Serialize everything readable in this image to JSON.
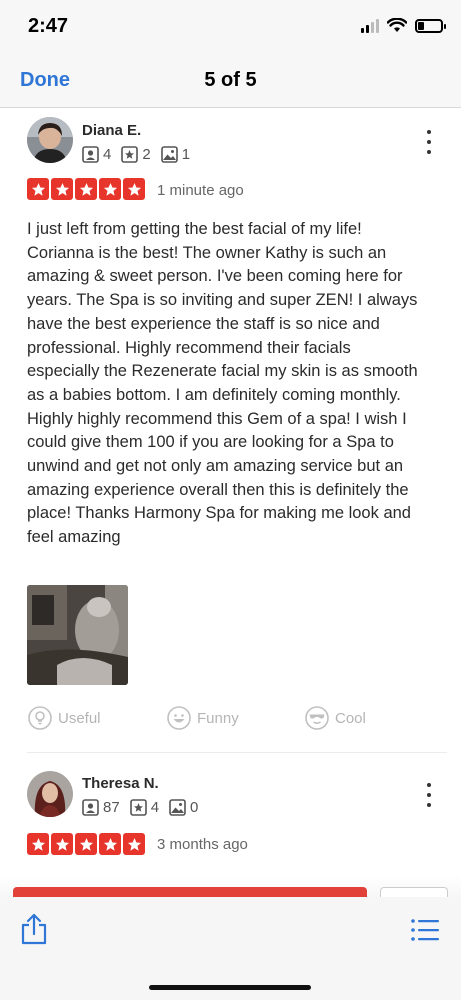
{
  "status_bar": {
    "time": "2:47"
  },
  "nav": {
    "done_label": "Done",
    "title": "5 of 5"
  },
  "reviews": [
    {
      "name": "Diana E.",
      "friends": "4",
      "reviews": "2",
      "photos": "1",
      "rating": 5,
      "date": "1 minute ago",
      "text": "I just left from getting the best facial of my life! Corianna is the best! The owner Kathy is such an amazing & sweet person. I've been coming here for years. The Spa is so inviting and super ZEN! I always have the best experience the staff is so nice and professional. Highly recommend their facials especially the Rezenerate facial my skin is as smooth as a babies bottom. I am definitely coming monthly. Highly highly recommend this Gem of a spa! I wish I could give them 100 if you are looking for a Spa to unwind and get not only am amazing service but an amazing experience overall then this is definitely the place! Thanks Harmony Spa for making me look and feel amazing"
    },
    {
      "name": "Theresa N.",
      "friends": "87",
      "reviews": "4",
      "photos": "0",
      "rating": 5,
      "date": "3 months ago"
    }
  ],
  "reactions": {
    "useful": "Useful",
    "funny": "Funny",
    "cool": "Cool"
  },
  "colors": {
    "accent": "#2f76d6",
    "star_red": "#e8352c",
    "muted": "#b5b5b5"
  },
  "icons": [
    "friends-icon",
    "review-count-icon",
    "photo-count-icon",
    "more-options-icon",
    "star-icon",
    "useful-icon",
    "funny-icon",
    "cool-icon",
    "share-icon",
    "list-icon"
  ]
}
